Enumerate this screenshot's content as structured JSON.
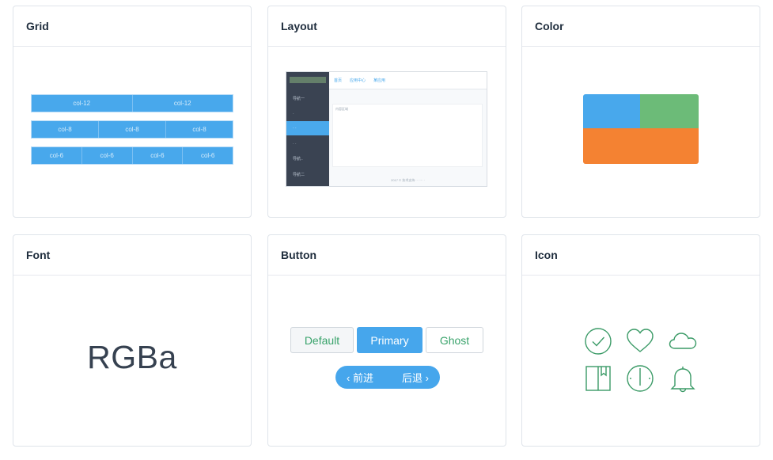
{
  "cards": {
    "grid": {
      "title": "Grid",
      "rows": [
        [
          "col-12",
          "col-12"
        ],
        [
          "col-8",
          "col-8",
          "col-8"
        ],
        [
          "col-6",
          "col-6",
          "col-6",
          "col-6"
        ]
      ]
    },
    "layout": {
      "title": "Layout",
      "top_nav": [
        "首页",
        "应用中心",
        "某应用"
      ],
      "side_nav": [
        "导航一",
        "·",
        "· ·",
        "· ·",
        "导航..",
        "导航二"
      ],
      "content_text": "内容区域",
      "footer_text": "2017 © 技术支持 ·· ···· ·"
    },
    "color": {
      "title": "Color",
      "colors": {
        "blue": "#48a8ec",
        "green": "#6cbb78",
        "orange": "#f48232"
      }
    },
    "font": {
      "title": "Font",
      "sample": "RGBa"
    },
    "button": {
      "title": "Button",
      "default_label": "Default",
      "primary_label": "Primary",
      "ghost_label": "Ghost",
      "prev_label": "‹ 前进",
      "next_label": "后退 ›"
    },
    "icon": {
      "title": "Icon",
      "icons": [
        "check-circle-icon",
        "heart-icon",
        "cloud-icon",
        "book-icon",
        "clock-icon",
        "bell-icon"
      ],
      "icon_color": "#3a9a66"
    }
  }
}
